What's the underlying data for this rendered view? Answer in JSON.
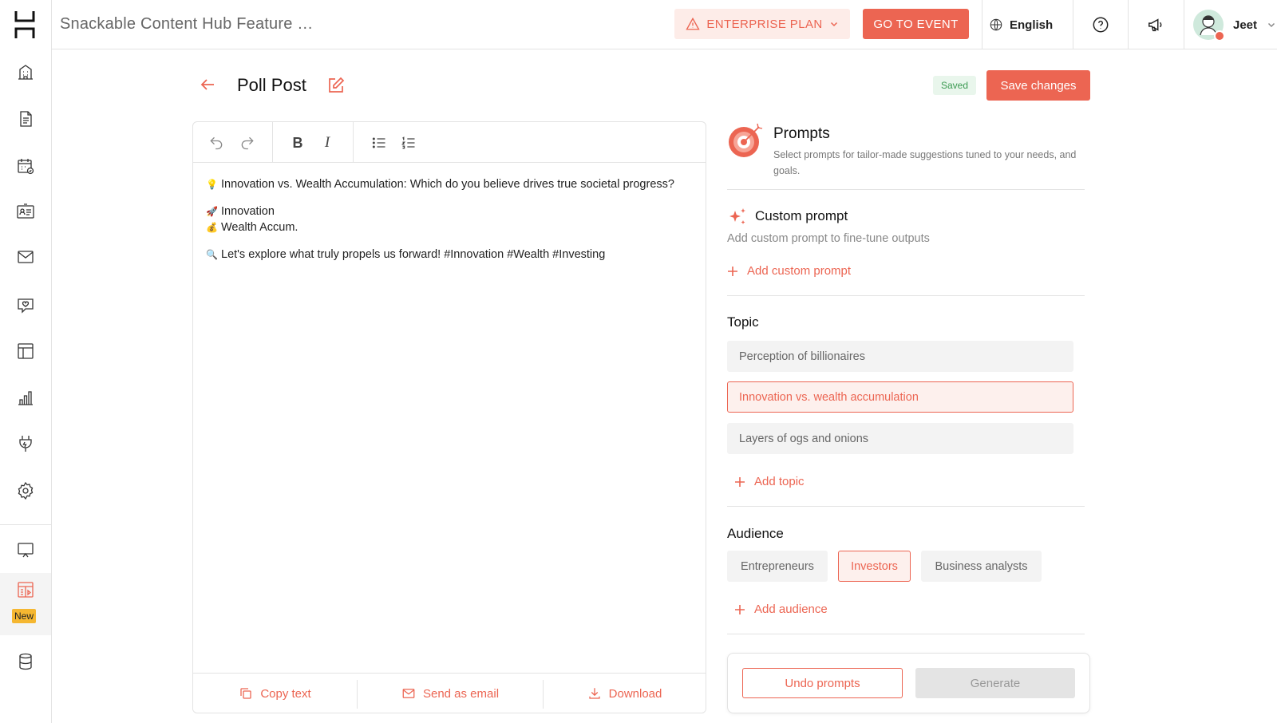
{
  "header": {
    "title": "Snackable Content Hub Feature …",
    "plan_label": "ENTERPRISE PLAN",
    "go_to_event_label": "GO TO EVENT",
    "language": "English",
    "username": "Jeet"
  },
  "sidebar": {
    "items": [
      {
        "icon": "building-icon"
      },
      {
        "icon": "document-icon"
      },
      {
        "icon": "calendar-icon"
      },
      {
        "icon": "contact-card-icon"
      },
      {
        "icon": "mail-icon"
      },
      {
        "icon": "chat-heart-icon"
      },
      {
        "icon": "layout-icon"
      },
      {
        "icon": "bar-chart-icon"
      },
      {
        "icon": "plug-icon"
      },
      {
        "icon": "gear-icon"
      },
      {
        "icon": "presentation-icon"
      },
      {
        "icon": "content-hub-icon",
        "badge": "New"
      },
      {
        "icon": "database-icon"
      }
    ]
  },
  "page": {
    "title": "Poll Post",
    "saved_label": "Saved",
    "save_label": "Save changes"
  },
  "editor": {
    "lines": {
      "question": "Innovation vs. Wealth Accumulation: Which do you believe drives true societal progress?",
      "option1": "Innovation",
      "option2": "Wealth Accum.",
      "cta": "Let's explore what truly propels us forward! #Innovation #Wealth #Investing"
    },
    "footer": {
      "copy_label": "Copy text",
      "email_label": "Send as email",
      "download_label": "Download"
    }
  },
  "prompts": {
    "title": "Prompts",
    "subtitle": "Select prompts for tailor-made suggestions tuned to your needs, and goals.",
    "custom": {
      "title": "Custom prompt",
      "subtitle": "Add custom prompt to fine-tune outputs",
      "add_label": "Add custom prompt"
    },
    "topic": {
      "title": "Topic",
      "items": [
        {
          "label": "Perception of billionaires",
          "selected": false
        },
        {
          "label": "Innovation vs. wealth accumulation",
          "selected": true
        },
        {
          "label": "Layers of ogs and onions",
          "selected": false
        }
      ],
      "add_label": "Add topic"
    },
    "audience": {
      "title": "Audience",
      "items": [
        {
          "label": "Entrepreneurs",
          "selected": false
        },
        {
          "label": "Investors",
          "selected": true
        },
        {
          "label": "Business analysts",
          "selected": false
        }
      ],
      "add_label": "Add audience"
    },
    "undo_label": "Undo prompts",
    "generate_label": "Generate"
  },
  "colors": {
    "accent": "#ec6552",
    "accent_light": "#fdece8",
    "saved_green": "#3c9a52",
    "new_badge": "#f5b731"
  }
}
